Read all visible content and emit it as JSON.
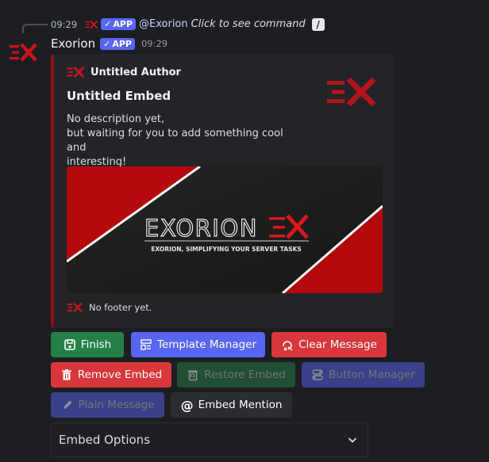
{
  "reply": {
    "time": "09:29",
    "badge": "APP",
    "mention": "@Exorion",
    "command_hint": "Click to see command"
  },
  "message": {
    "username": "Exorion",
    "badge": "APP",
    "time": "09:29"
  },
  "embed": {
    "accent_color": "#8b0f14",
    "author": "Untitled Author",
    "title": "Untitled Embed",
    "description_lines": [
      "No description yet,",
      "but waiting for you to add something cool and",
      "interesting!"
    ],
    "banner": {
      "brand": "EXORION",
      "tagline": "EXORION, SIMPLIFYING YOUR SERVER TASKS"
    },
    "footer": "No footer yet."
  },
  "buttons": {
    "finish": "Finish",
    "template_manager": "Template Manager",
    "clear_message": "Clear Message",
    "remove_embed": "Remove Embed",
    "restore_embed": "Restore Embed",
    "button_manager": "Button Manager",
    "plain_message": "Plain Message",
    "embed_mention": "Embed Mention"
  },
  "select": {
    "placeholder": "Embed Options"
  },
  "colors": {
    "background": "#1d1e22",
    "success": "#248046",
    "primary": "#5865f2",
    "danger": "#da373c",
    "secondary": "#2b2d31",
    "brand_red": "#c8151b"
  }
}
